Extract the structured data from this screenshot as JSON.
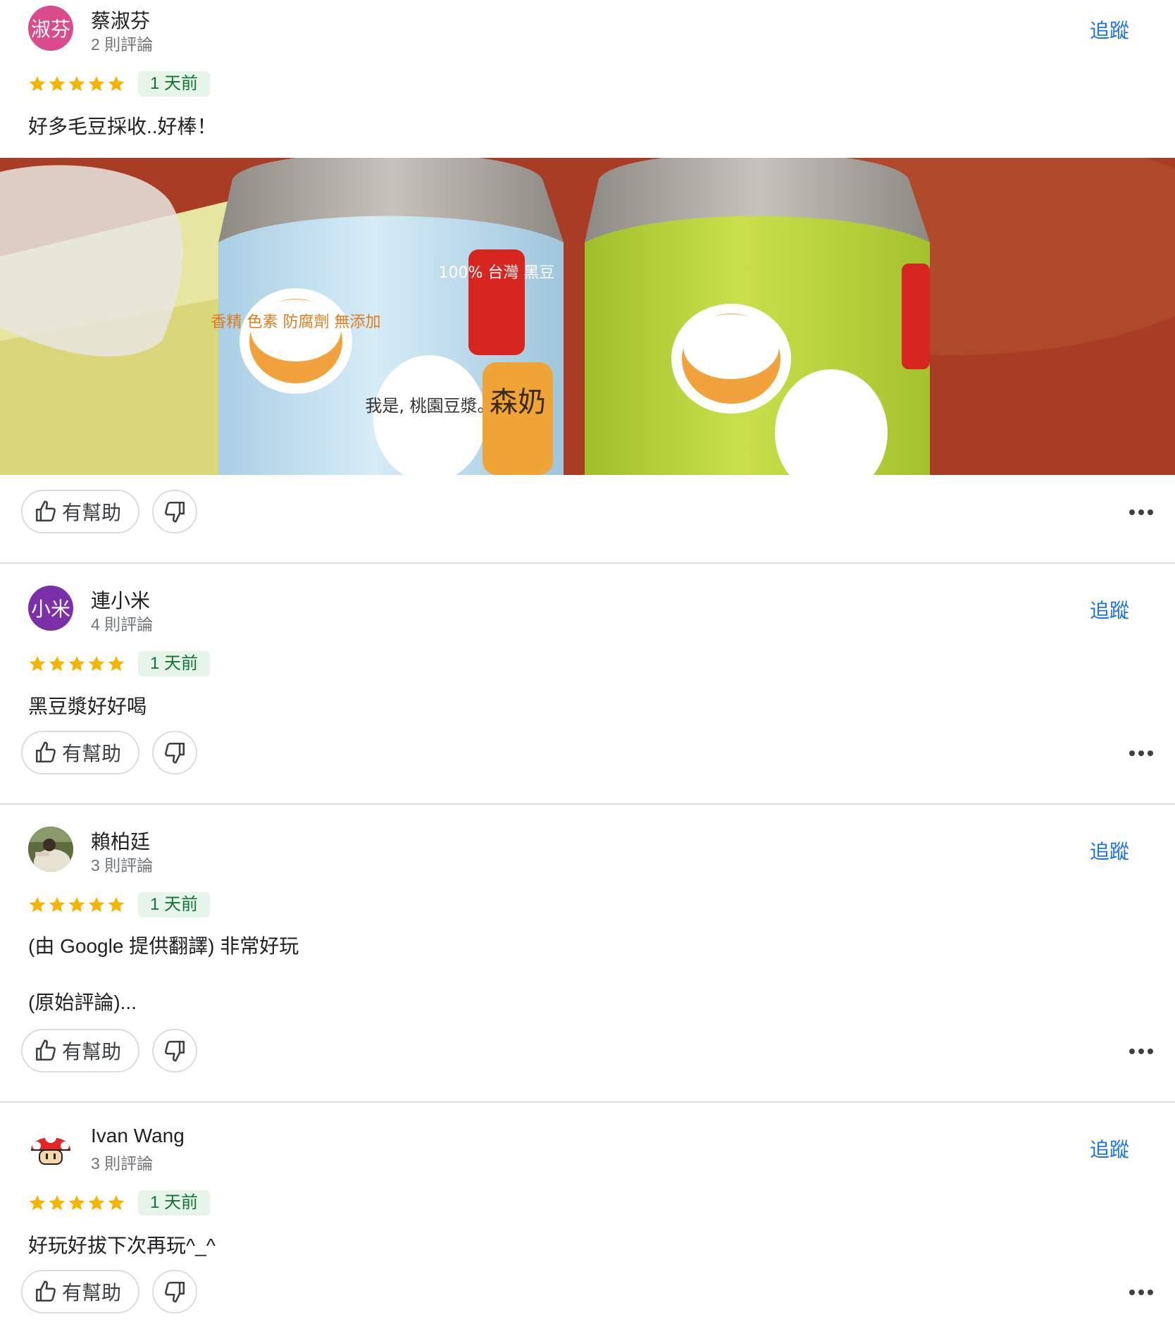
{
  "colors": {
    "accent": "#1a73e8",
    "star": "#f4b400",
    "time_bg": "#e6f4ea",
    "time_fg": "#137333"
  },
  "buttons": {
    "helpful_label": "有幫助"
  },
  "reviews": [
    {
      "avatar_text": "淑芬",
      "avatar_color": "#d94b8a",
      "name": "蔡淑芬",
      "review_count": "2 則評論",
      "follow_label": "追蹤",
      "rating": 5,
      "time": "1 天前",
      "text": "好多毛豆採收..好棒！",
      "photo": {
        "bottle_labels": [
          "100% 台灣 黑豆",
          "香精 色素 防腐劑 無添加",
          "我是, 桃園豆漿。",
          "森奶"
        ]
      }
    },
    {
      "avatar_text": "小米",
      "avatar_color": "#7b2fa8",
      "name": "連小米",
      "review_count": "4 則評論",
      "follow_label": "追蹤",
      "rating": 5,
      "time": "1 天前",
      "text": "黑豆漿好好喝"
    },
    {
      "avatar_text": "",
      "name": "賴柏廷",
      "review_count": "3 則評論",
      "follow_label": "追蹤",
      "rating": 5,
      "time": "1 天前",
      "text": "(由 Google 提供翻譯) 非常好玩\n\n(原始評論)..."
    },
    {
      "avatar_text": "",
      "name": "Ivan Wang",
      "review_count": "3 則評論",
      "follow_label": "追蹤",
      "rating": 5,
      "time": "1 天前",
      "text": "好玩好拔下次再玩^_^"
    }
  ]
}
